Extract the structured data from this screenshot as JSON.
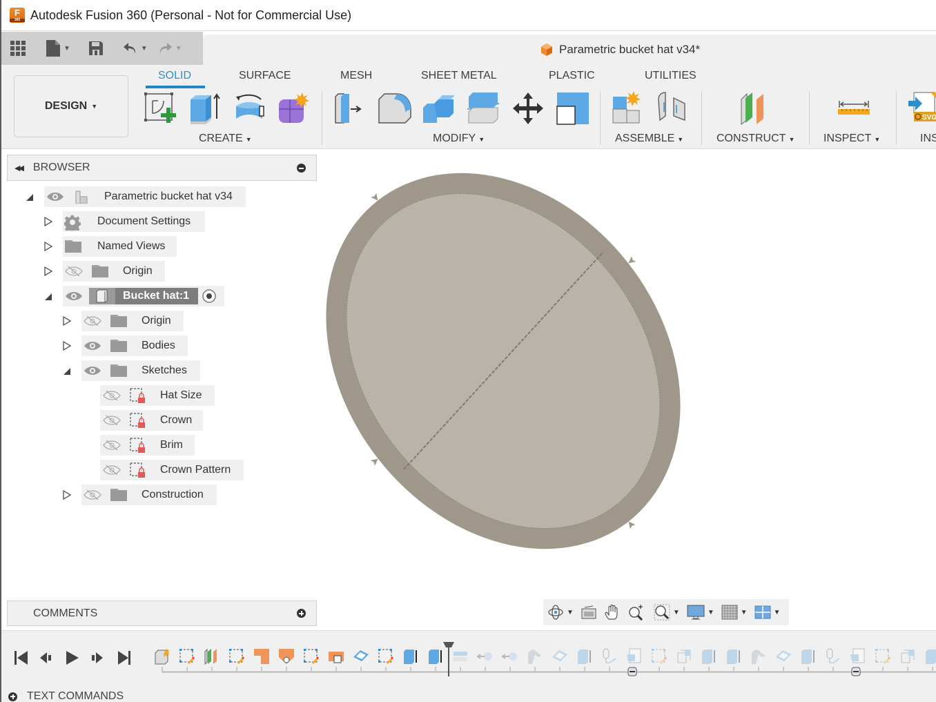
{
  "window": {
    "title": "Autodesk Fusion 360 (Personal - Not for Commercial Use)",
    "logo_letter": "F",
    "logo_sub": "360"
  },
  "quick_access": {
    "icons": [
      "app-grid-icon",
      "file-icon",
      "save-icon",
      "undo-icon",
      "redo-icon"
    ]
  },
  "document": {
    "title": "Parametric bucket hat v34*"
  },
  "ribbon": {
    "workspace": "DESIGN",
    "tabs": [
      {
        "label": "SOLID",
        "active": true
      },
      {
        "label": "SURFACE",
        "active": false
      },
      {
        "label": "MESH",
        "active": false
      },
      {
        "label": "SHEET METAL",
        "active": false
      },
      {
        "label": "PLASTIC",
        "active": false
      },
      {
        "label": "UTILITIES",
        "active": false
      }
    ],
    "groups": [
      {
        "label": "CREATE",
        "tools": [
          "create-sketch-icon",
          "extrude-icon",
          "revolve-icon",
          "create-form-icon"
        ]
      },
      {
        "label": "MODIFY",
        "tools": [
          "press-pull-icon",
          "fillet-icon",
          "combine-icon",
          "split-body-icon",
          "move-copy-icon",
          "scale-icon"
        ]
      },
      {
        "label": "ASSEMBLE",
        "tools": [
          "new-component-icon",
          "joint-icon"
        ]
      },
      {
        "label": "CONSTRUCT",
        "tools": [
          "offset-plane-icon"
        ]
      },
      {
        "label": "INSPECT",
        "tools": [
          "measure-icon"
        ]
      },
      {
        "label": "INS",
        "tools": [
          "insert-svg-icon"
        ]
      }
    ]
  },
  "browser": {
    "title": "BROWSER",
    "tree": [
      {
        "label": "Parametric bucket hat v34",
        "state": "expanded",
        "visible": true
      },
      {
        "label": "Document Settings",
        "state": "collapsed"
      },
      {
        "label": "Named Views",
        "state": "collapsed"
      },
      {
        "label": "Origin",
        "state": "collapsed",
        "visible": false
      },
      {
        "label": "Bucket hat:1",
        "state": "expanded",
        "visible": true,
        "active": true
      },
      {
        "label": "Origin",
        "state": "collapsed",
        "visible": false
      },
      {
        "label": "Bodies",
        "state": "collapsed",
        "visible": true
      },
      {
        "label": "Sketches",
        "state": "expanded",
        "visible": true
      },
      {
        "label": "Hat Size",
        "visible": false
      },
      {
        "label": "Crown",
        "visible": false
      },
      {
        "label": "Brim",
        "visible": false
      },
      {
        "label": "Crown Pattern",
        "visible": false
      },
      {
        "label": "Construction",
        "state": "collapsed",
        "visible": false
      }
    ]
  },
  "comments": {
    "title": "COMMENTS"
  },
  "navbar": {
    "icons": [
      "orbit-icon",
      "look-at-icon",
      "pan-icon",
      "zoom-icon",
      "zoom-window-icon",
      "display-settings-icon",
      "grid-icon",
      "viewports-icon"
    ]
  },
  "timeline": {
    "controls": [
      "go-to-start",
      "step-back",
      "play",
      "step-forward",
      "go-to-end"
    ]
  },
  "text_commands": {
    "label": "TEXT COMMANDS"
  },
  "colors": {
    "accent": "#1f87c8",
    "body_outer": "#9e978a",
    "body_inner": "#b8b4a9"
  }
}
